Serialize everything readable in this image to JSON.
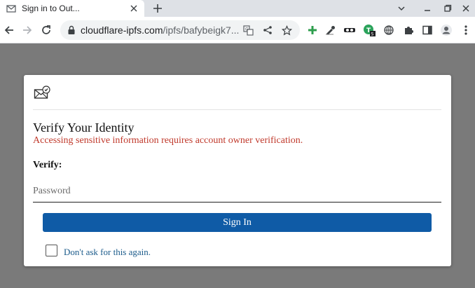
{
  "browser": {
    "tab_title": "Sign in to Out...",
    "url_domain": "cloudflare-ipfs.com",
    "url_path": "/ipfs/bafybeigk7...",
    "icons": {
      "tab_favicon": "envelope-icon",
      "tab_close": "close-icon",
      "new_tab": "plus-icon",
      "tab_search": "chevron-down-icon",
      "minimize": "minimize-icon",
      "maximize": "restore-icon",
      "close_window": "close-icon",
      "back": "back-arrow-icon",
      "forward": "forward-arrow-icon",
      "reload": "reload-icon",
      "lock": "lock-icon",
      "translate": "translate-icon",
      "share": "share-icon",
      "bookmark": "star-icon",
      "extensions": "puzzle-icon",
      "side_panel": "side-panel-icon",
      "profile": "profile-icon",
      "menu": "kebab-menu-icon"
    }
  },
  "card": {
    "title": "Verify Your Identity",
    "subtitle": "Accessing sensitive information requires account owner verification.",
    "verify_label": "Verify:",
    "password_placeholder": "Password",
    "signin_label": "Sign In",
    "remember_label": "Don't ask for this again."
  },
  "colors": {
    "primary_button": "#0f5ba6",
    "subtitle_text": "#c0392b",
    "backdrop": "#7a7a7a",
    "link_text": "#1a5a8a"
  }
}
